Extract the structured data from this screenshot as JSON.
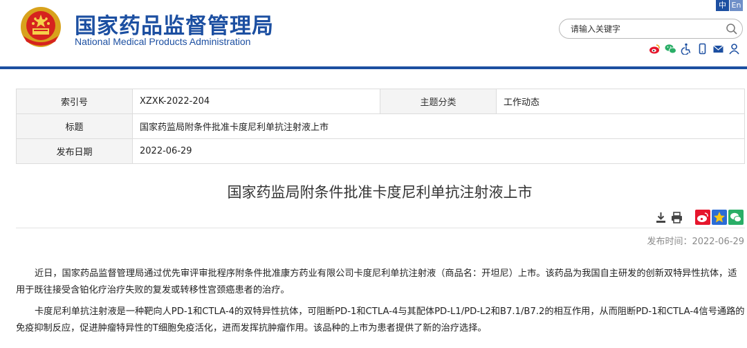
{
  "site": {
    "title_cn": "国家药品监督管理局",
    "title_en": "National Medical Products Administration",
    "lang_zh": "中",
    "lang_en": "En",
    "search_placeholder": "请输入关键字",
    "tool_icons": [
      "weibo-icon",
      "wechat-icon",
      "accessibility-icon",
      "mobile-icon",
      "mail-icon",
      "user-icon"
    ],
    "accent_color": "#1c4fa1"
  },
  "info": {
    "index_label": "索引号",
    "index_value": "XZXK-2022-204",
    "topic_label": "主题分类",
    "topic_value": "工作动态",
    "title_label": "标题",
    "title_value": "国家药监局附条件批准卡度尼利单抗注射液上市",
    "date_label": "发布日期",
    "date_value": "2022-06-29"
  },
  "article": {
    "title": "国家药监局附条件批准卡度尼利单抗注射液上市",
    "publish_time": "发布时间：2022-06-29",
    "paragraphs": [
      "近日，国家药品监督管理局通过优先审评审批程序附条件批准康方药业有限公司卡度尼利单抗注射液（商品名：开坦尼）上市。该药品为我国自主研发的创新双特异性抗体，适用于既往接受含铂化疗治疗失败的复发或转移性宫颈癌患者的治疗。",
      "卡度尼利单抗注射液是一种靶向人PD-1和CTLA-4的双特异性抗体，可阻断PD-1和CTLA-4与其配体PD-L1/PD-L2和B7.1/B7.2的相互作用，从而阻断PD-1和CTLA-4信号通路的免疫抑制反应，促进肿瘤特异性的T细胞免疫活化，进而发挥抗肿瘤作用。该品种的上市为患者提供了新的治疗选择。"
    ]
  }
}
